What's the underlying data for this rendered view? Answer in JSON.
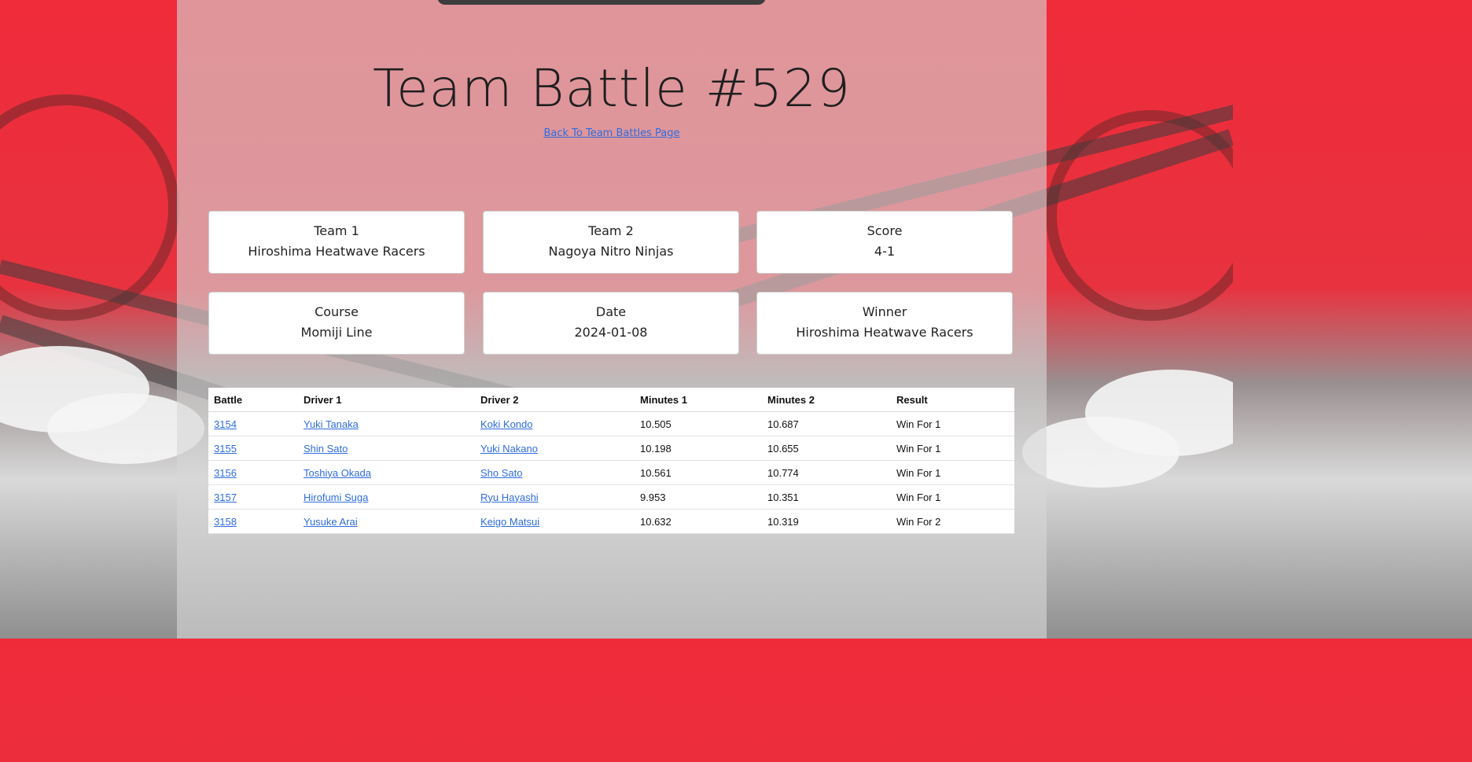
{
  "page": {
    "title": "Team Battle #529",
    "back_link": "Back To Team Battles Page"
  },
  "summary": {
    "team1": {
      "label": "Team 1",
      "value": "Hiroshima Heatwave Racers"
    },
    "team2": {
      "label": "Team 2",
      "value": "Nagoya Nitro Ninjas"
    },
    "score": {
      "label": "Score",
      "value": "4-1"
    },
    "course": {
      "label": "Course",
      "value": "Momiji Line"
    },
    "date": {
      "label": "Date",
      "value": "2024-01-08"
    },
    "winner": {
      "label": "Winner",
      "value": "Hiroshima Heatwave Racers"
    }
  },
  "table": {
    "headers": [
      "Battle",
      "Driver 1",
      "Driver 2",
      "Minutes 1",
      "Minutes 2",
      "Result"
    ],
    "rows": [
      {
        "battle": "3154",
        "driver1": "Yuki Tanaka",
        "driver2": "Koki Kondo",
        "minutes1": "10.505",
        "minutes2": "10.687",
        "result": "Win For 1"
      },
      {
        "battle": "3155",
        "driver1": "Shin Sato",
        "driver2": "Yuki Nakano",
        "minutes1": "10.198",
        "minutes2": "10.655",
        "result": "Win For 1"
      },
      {
        "battle": "3156",
        "driver1": "Toshiya Okada",
        "driver2": "Sho Sato",
        "minutes1": "10.561",
        "minutes2": "10.774",
        "result": "Win For 1"
      },
      {
        "battle": "3157",
        "driver1": "Hirofumi Suga",
        "driver2": "Ryu Hayashi",
        "minutes1": "9.953",
        "minutes2": "10.351",
        "result": "Win For 1"
      },
      {
        "battle": "3158",
        "driver1": "Yusuke Arai",
        "driver2": "Keigo Matsui",
        "minutes1": "10.632",
        "minutes2": "10.319",
        "result": "Win For 2"
      }
    ]
  },
  "colors": {
    "link": "#2e6de0",
    "accent_red": "#ef2b3a"
  }
}
